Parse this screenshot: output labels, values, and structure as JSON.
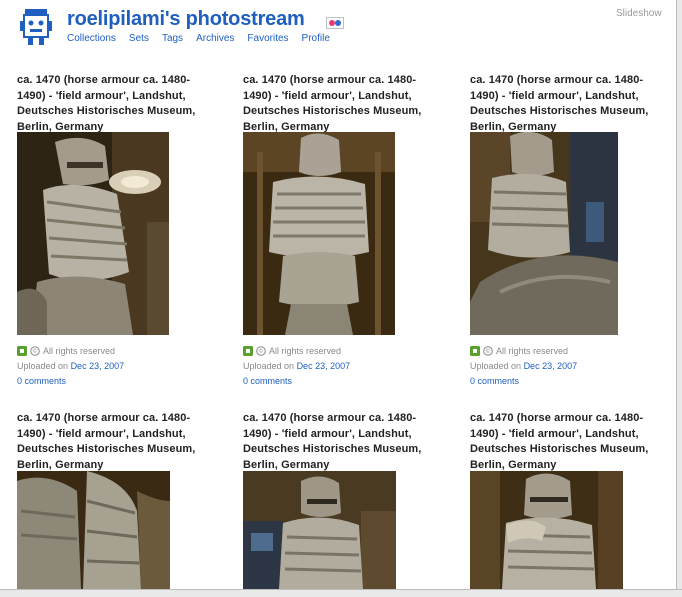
{
  "header": {
    "title": "roelipilami's photostream",
    "slideshow": "Slideshow",
    "nav": [
      "Collections",
      "Sets",
      "Tags",
      "Archives",
      "Favorites",
      "Profile"
    ]
  },
  "photos": [
    {
      "title_lines": [
        "ca. 1470 (horse armour ca. 1480-",
        "1490) - 'field armour', Landshut,",
        "Deutsches Historisches Museum,",
        "Berlin, Germany"
      ],
      "license": "All rights reserved",
      "uploaded_prefix": "Uploaded on",
      "uploaded_date": "Dec 23, 2007",
      "comments": "0 comments"
    },
    {
      "title_lines": [
        "ca. 1470 (horse armour ca. 1480-",
        "1490) - 'field armour', Landshut,",
        "Deutsches Historisches Museum,",
        "Berlin, Germany"
      ],
      "license": "All rights reserved",
      "uploaded_prefix": "Uploaded on",
      "uploaded_date": "Dec 23, 2007",
      "comments": "0 comments"
    },
    {
      "title_lines": [
        "ca. 1470 (horse armour ca. 1480-",
        "1490) - 'field armour', Landshut,",
        "Deutsches Historisches Museum,",
        "Berlin, Germany"
      ],
      "license": "All rights reserved",
      "uploaded_prefix": "Uploaded on",
      "uploaded_date": "Dec 23, 2007",
      "comments": "0 comments"
    },
    {
      "title_lines": [
        "ca. 1470 (horse armour ca. 1480-",
        "1490) - 'field armour', Landshut,",
        "Deutsches Historisches Museum,",
        "Berlin, Germany"
      ]
    },
    {
      "title_lines": [
        "ca. 1470 (horse armour ca. 1480-",
        "1490) - 'field armour', Landshut,",
        "Deutsches Historisches Museum,",
        "Berlin, Germany"
      ]
    },
    {
      "title_lines": [
        "ca. 1470 (horse armour ca. 1480-",
        "1490) - 'field armour', Landshut,",
        "Deutsches Historisches Museum,",
        "Berlin, Germany"
      ]
    }
  ],
  "colors": {
    "link": "#1f5fbf",
    "license_green": "#5aa02c",
    "photo_background": "#3b2a12",
    "armour_steel": "#b8b2a4"
  },
  "icons": {
    "buddy": "flickr-buddy-icon",
    "license": "copyright-icon",
    "personal": "green-square-icon"
  }
}
